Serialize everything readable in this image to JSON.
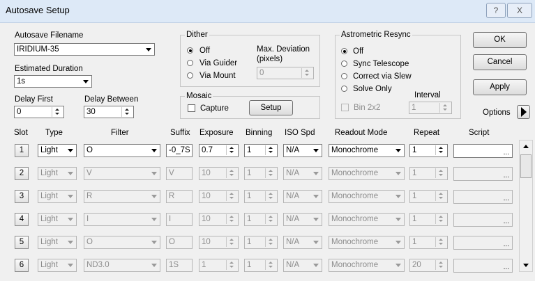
{
  "window": {
    "title": "Autosave Setup",
    "help_label": "?",
    "close_label": "X"
  },
  "filename": {
    "label": "Autosave Filename",
    "value": "IRIDIUM-35"
  },
  "duration": {
    "label": "Estimated Duration",
    "value": "1s"
  },
  "delay_first": {
    "label": "Delay First",
    "value": "0"
  },
  "delay_between": {
    "label": "Delay Between",
    "value": "30"
  },
  "dither": {
    "title": "Dither",
    "options": [
      "Off",
      "Via Guider",
      "Via Mount"
    ],
    "selected": "Off",
    "max_dev_label": "Max. Deviation\n(pixels)",
    "max_dev_line1": "Max. Deviation",
    "max_dev_line2": "(pixels)",
    "max_dev_value": "0"
  },
  "mosaic": {
    "title": "Mosaic",
    "capture_label": "Capture",
    "setup_label": "Setup"
  },
  "resync": {
    "title": "Astrometric Resync",
    "options": [
      "Off",
      "Sync Telescope",
      "Correct via Slew",
      "Solve Only"
    ],
    "selected": "Off",
    "bin_label": "Bin 2x2",
    "interval_label": "Interval",
    "interval_value": "1"
  },
  "buttons": {
    "ok": "OK",
    "cancel": "Cancel",
    "apply": "Apply",
    "options": "Options"
  },
  "columns": [
    "Slot",
    "Type",
    "Filter",
    "Suffix",
    "Exposure",
    "Binning",
    "ISO Spd",
    "Readout Mode",
    "Repeat",
    "Script"
  ],
  "rows": [
    {
      "slot": "1",
      "type": "Light",
      "filter": "O",
      "suffix": "-0_7S",
      "exposure": "0.7",
      "binning": "1",
      "iso": "N/A",
      "readout": "Monochrome",
      "repeat": "1",
      "script": "...",
      "enabled": true
    },
    {
      "slot": "2",
      "type": "Light",
      "filter": "V",
      "suffix": "V",
      "exposure": "10",
      "binning": "1",
      "iso": "N/A",
      "readout": "Monochrome",
      "repeat": "1",
      "script": "...",
      "enabled": false
    },
    {
      "slot": "3",
      "type": "Light",
      "filter": "R",
      "suffix": "R",
      "exposure": "10",
      "binning": "1",
      "iso": "N/A",
      "readout": "Monochrome",
      "repeat": "1",
      "script": "...",
      "enabled": false
    },
    {
      "slot": "4",
      "type": "Light",
      "filter": "I",
      "suffix": "I",
      "exposure": "10",
      "binning": "1",
      "iso": "N/A",
      "readout": "Monochrome",
      "repeat": "1",
      "script": "...",
      "enabled": false
    },
    {
      "slot": "5",
      "type": "Light",
      "filter": "O",
      "suffix": "O",
      "exposure": "10",
      "binning": "1",
      "iso": "N/A",
      "readout": "Monochrome",
      "repeat": "1",
      "script": "...",
      "enabled": false
    },
    {
      "slot": "6",
      "type": "Light",
      "filter": "ND3.0",
      "suffix": "1S",
      "exposure": "1",
      "binning": "1",
      "iso": "N/A",
      "readout": "Monochrome",
      "repeat": "20",
      "script": "...",
      "enabled": false
    }
  ],
  "colors": {
    "titlebar": "#dde9f7",
    "dialog_bg": "#f0f0f0",
    "disabled_text": "#8c8c8c"
  }
}
